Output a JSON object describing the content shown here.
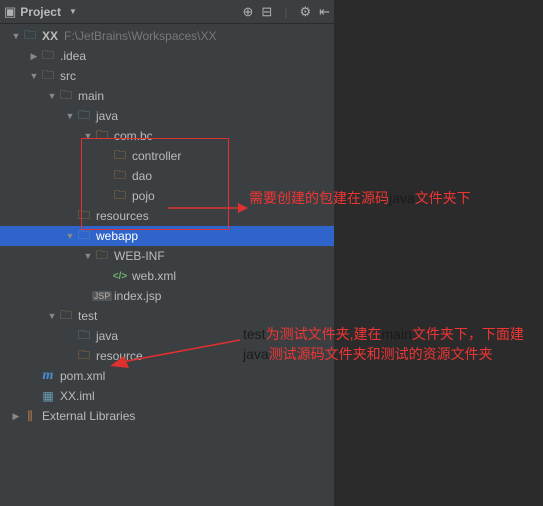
{
  "toolbar": {
    "title": "Project",
    "icons": {
      "target": "⊕",
      "collapse": "⊟",
      "gear": "⚙",
      "hide": "⇤"
    }
  },
  "tree": [
    {
      "depth": 0,
      "arrow": "down",
      "icon": "folder-teal",
      "label": "XX",
      "path": "F:\\JetBrains\\Workspaces\\XX",
      "bold": true
    },
    {
      "depth": 1,
      "arrow": "right",
      "icon": "folder",
      "label": ".idea"
    },
    {
      "depth": 1,
      "arrow": "down",
      "icon": "folder",
      "label": "src"
    },
    {
      "depth": 2,
      "arrow": "down",
      "icon": "folder",
      "label": "main"
    },
    {
      "depth": 3,
      "arrow": "down",
      "icon": "folder-blue",
      "label": "java"
    },
    {
      "depth": 4,
      "arrow": "down",
      "icon": "pkg",
      "label": "com.bc"
    },
    {
      "depth": 5,
      "arrow": "none",
      "icon": "pkg",
      "label": "controller"
    },
    {
      "depth": 5,
      "arrow": "none",
      "icon": "pkg",
      "label": "dao"
    },
    {
      "depth": 5,
      "arrow": "none",
      "icon": "pkg",
      "label": "pojo"
    },
    {
      "depth": 3,
      "arrow": "none",
      "icon": "folder-orange",
      "label": "resources"
    },
    {
      "depth": 3,
      "arrow": "down",
      "icon": "folder-blue",
      "label": "webapp",
      "selected": true
    },
    {
      "depth": 4,
      "arrow": "down",
      "icon": "folder",
      "label": "WEB-INF"
    },
    {
      "depth": 5,
      "arrow": "none",
      "icon": "xml",
      "label": "web.xml"
    },
    {
      "depth": 4,
      "arrow": "none",
      "icon": "jsp",
      "label": "index.jsp"
    },
    {
      "depth": 2,
      "arrow": "down",
      "icon": "folder",
      "label": "test"
    },
    {
      "depth": 3,
      "arrow": "none",
      "icon": "folder-blue",
      "label": "java"
    },
    {
      "depth": 3,
      "arrow": "none",
      "icon": "folder-orange",
      "label": "resource"
    },
    {
      "depth": 1,
      "arrow": "none",
      "icon": "maven",
      "label": "pom.xml"
    },
    {
      "depth": 1,
      "arrow": "none",
      "icon": "iml",
      "label": "XX.iml"
    },
    {
      "depth": 0,
      "arrow": "right",
      "icon": "lib",
      "label": "External Libraries"
    }
  ],
  "annotations": {
    "a1_red": "需要创建的包建在源码",
    "a1_black": "java",
    "a1_red2": "文件夹下",
    "a2": {
      "l1_black": "test",
      "l1_red": "为测试文件夹,建在",
      "l1_black2": "main",
      "l1_red2": "文件夹下，下面建",
      "l2_black": "java",
      "l2_red": "测试源码文件夹和测试的资源文件夹"
    }
  }
}
